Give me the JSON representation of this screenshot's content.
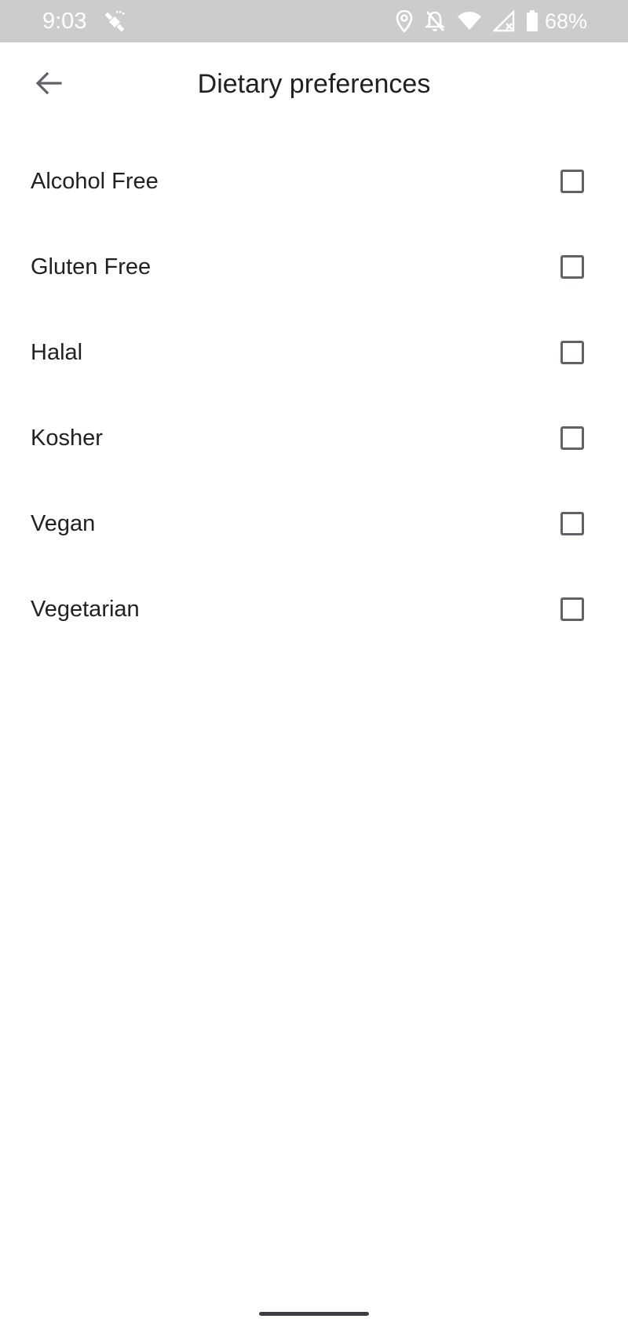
{
  "status_bar": {
    "time": "9:03",
    "left_icons": [
      "satellite-icon"
    ],
    "right_icons": [
      "location-icon",
      "notifications-off-icon",
      "wifi-icon",
      "cellular-no-data-icon",
      "battery-icon"
    ],
    "battery_percent": "68%",
    "background_color": "#cccccc"
  },
  "app_bar": {
    "back_icon": "arrow-back-icon",
    "title": "Dietary preferences"
  },
  "preferences": [
    {
      "label": "Alcohol Free",
      "checked": false
    },
    {
      "label": "Gluten Free",
      "checked": false
    },
    {
      "label": "Halal",
      "checked": false
    },
    {
      "label": "Kosher",
      "checked": false
    },
    {
      "label": "Vegan",
      "checked": false
    },
    {
      "label": "Vegetarian",
      "checked": false
    }
  ],
  "colors": {
    "text_primary": "#202124",
    "checkbox_border": "#5f6368",
    "background": "#ffffff"
  }
}
